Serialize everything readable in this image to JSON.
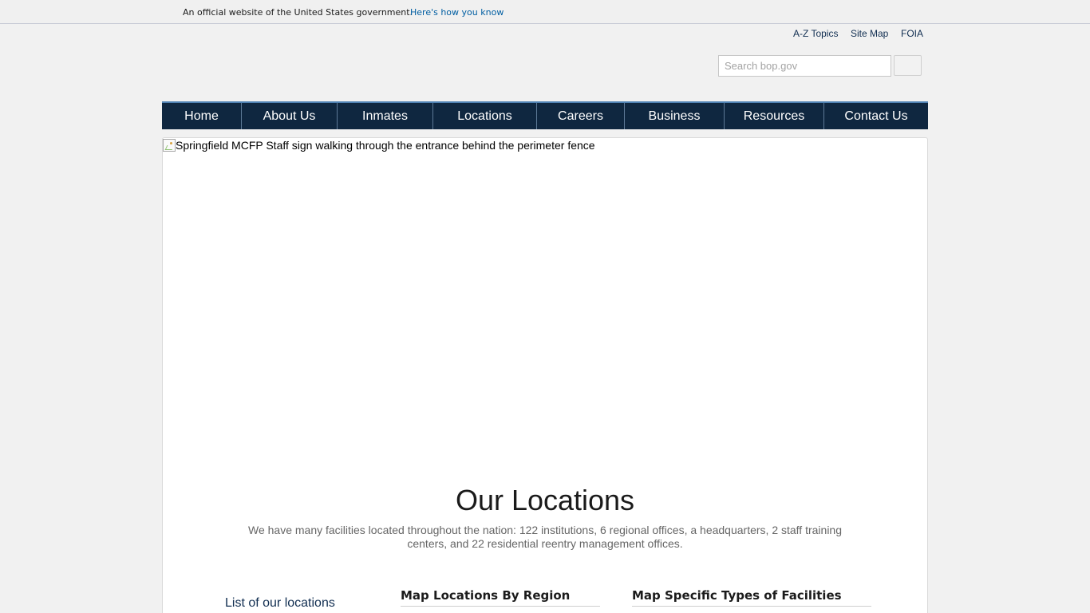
{
  "gov_banner": {
    "text": "An official website of the United States government.",
    "how_link": "Here's how you know"
  },
  "utility": {
    "links": [
      "A-Z Topics",
      "Site Map",
      "FOIA"
    ]
  },
  "search": {
    "placeholder": "Search bop.gov",
    "value": ""
  },
  "nav": {
    "items": [
      "Home",
      "About Us",
      "Inmates",
      "Locations",
      "Careers",
      "Business",
      "Resources",
      "Contact Us"
    ]
  },
  "hero": {
    "alt_text": "Springfield MCFP Staff sign walking through the entrance behind the perimeter fence"
  },
  "main": {
    "title": "Our Locations",
    "description": "We have many facilities located throughout the nation: 122 institutions, 6 regional offices, a headquarters, 2 staff training centers, and 22 residential reentry management offices.",
    "list_link": "List of our locations",
    "region_heading": "Map Locations By Region",
    "types_heading": "Map Specific Types of Facilities"
  },
  "colors": {
    "nav_background": "#0f2740",
    "nav_accent": "#4f82b4",
    "link": "#112e51",
    "banner_link": "#005ea2"
  }
}
